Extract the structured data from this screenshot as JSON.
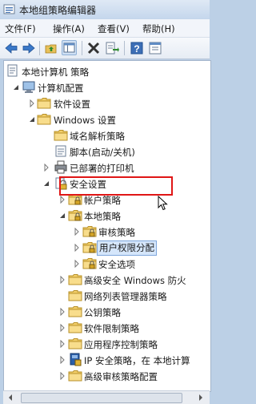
{
  "window": {
    "title": "本地组策略编辑器"
  },
  "menu": {
    "file": "文件(F)",
    "action": "操作(A)",
    "view": "查看(V)",
    "help": "帮助(H)"
  },
  "toolbar": {
    "back": "back-icon",
    "forward": "forward-icon",
    "up": "up-icon",
    "show_hide_tree": "show-hide-tree-icon",
    "delete": "delete-icon",
    "export": "export-list-icon",
    "help": "help-icon",
    "properties": "properties-icon"
  },
  "tree": {
    "root": "本地计算机 策略",
    "computer_config": "计算机配置",
    "software_settings": "软件设置",
    "windows_settings": "Windows 设置",
    "dns_policy": "域名解析策略",
    "scripts": "脚本(启动/关机)",
    "printers": "已部署的打印机",
    "security_settings": "安全设置",
    "account_policies": "帐户策略",
    "local_policies": "本地策略",
    "audit_policy": "审核策略",
    "user_rights": "用户权限分配",
    "security_options": "安全选项",
    "windows_firewall": "高级安全 Windows 防火",
    "network_list": "网络列表管理器策略",
    "public_key": "公钥策略",
    "software_restriction": "软件限制策略",
    "app_control": "应用程序控制策略",
    "ip_security": "IP 安全策略，在 本地计算",
    "advanced_audit": "高级审核策略配置"
  },
  "colors": {
    "highlight_box": "#e01616",
    "selection": "#d5e6fb"
  }
}
